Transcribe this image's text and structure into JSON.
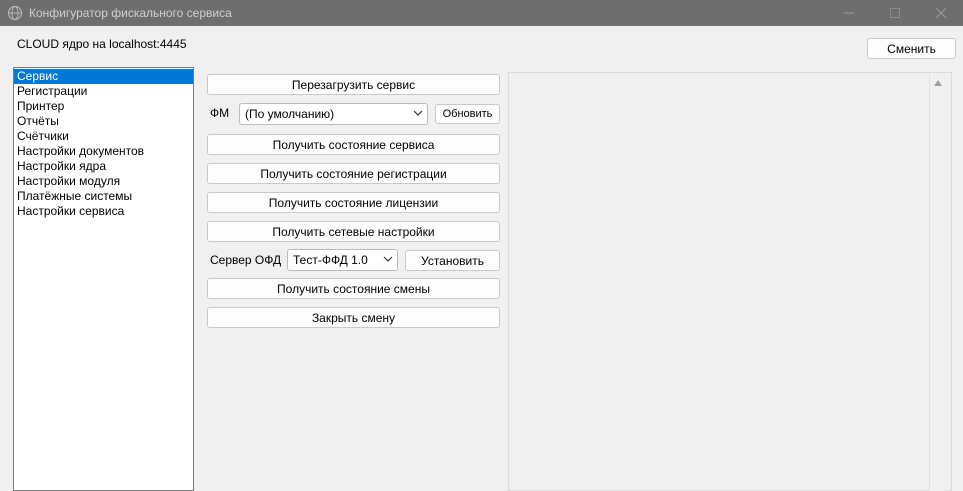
{
  "window": {
    "title": "Конфигуратор фискального сервиса",
    "icon": "globe-icon"
  },
  "connection": {
    "label": "CLOUD ядро на localhost:4445",
    "change_button": "Сменить"
  },
  "nav": {
    "items": [
      {
        "label": "Сервис",
        "selected": true
      },
      {
        "label": "Регистрации"
      },
      {
        "label": "Принтер"
      },
      {
        "label": "Отчёты"
      },
      {
        "label": "Счётчики"
      },
      {
        "label": "Настройки документов"
      },
      {
        "label": "Настройки ядра"
      },
      {
        "label": "Настройки модуля"
      },
      {
        "label": "Платёжные системы"
      },
      {
        "label": "Настройки сервиса"
      }
    ]
  },
  "actions": {
    "restart_service": "Перезагрузить сервис",
    "fm_label": "ФМ",
    "fm_value": "(По умолчанию)",
    "refresh": "Обновить",
    "get_service_state": "Получить состояние сервиса",
    "get_registration_state": "Получить состояние регистрации",
    "get_license_state": "Получить состояние лицензии",
    "get_network_settings": "Получить сетевые настройки",
    "ofd_label": "Сервер ОФД",
    "ofd_value": "Тест-ФФД 1.0",
    "install": "Установить",
    "get_shift_state": "Получить состояние смены",
    "close_shift": "Закрыть смену"
  }
}
